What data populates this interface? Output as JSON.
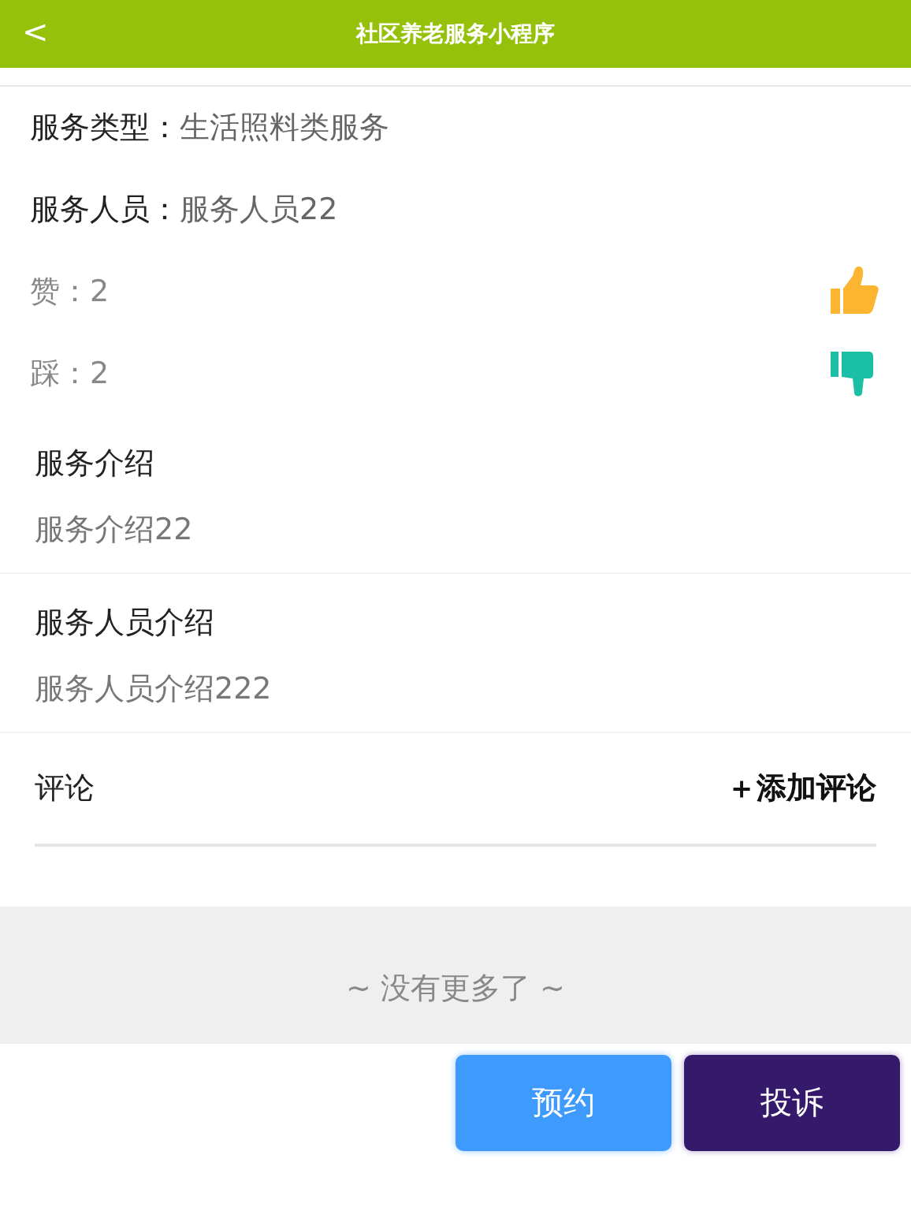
{
  "header": {
    "back": "<",
    "title": "社区养老服务小程序"
  },
  "fields": [
    {
      "label": "服务类型：",
      "value": "生活照料类服务"
    },
    {
      "label": "服务人员：",
      "value": "服务人员22"
    }
  ],
  "votes": [
    {
      "kind": "up",
      "text": "赞：2"
    },
    {
      "kind": "down",
      "text": "踩：2"
    }
  ],
  "sections": [
    {
      "title": "服务介绍",
      "body": "服务介绍22"
    },
    {
      "title": "服务人员介绍",
      "body": "服务人员介绍222"
    }
  ],
  "comments": {
    "title": "评论",
    "add": "＋添加评论"
  },
  "end_note": "~ 没有更多了 ~",
  "buttons": [
    {
      "kind": "primary",
      "label": "预约"
    },
    {
      "kind": "complain",
      "label": "投诉"
    }
  ]
}
